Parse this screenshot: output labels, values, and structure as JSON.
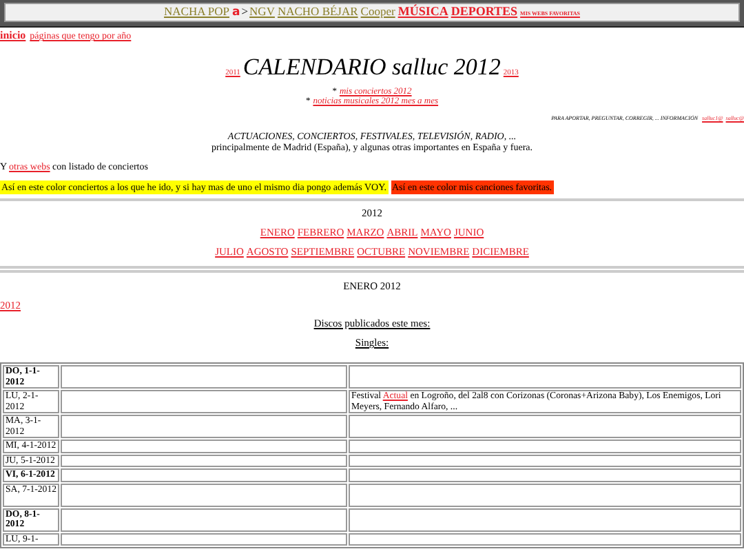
{
  "top_bar": [
    {
      "text": "NACHA POP",
      "kind": "olive"
    },
    {
      "text": "a",
      "kind": "sans"
    },
    {
      "text": ">",
      "kind": "plain"
    },
    {
      "text": "NGV",
      "kind": "olive"
    },
    {
      "text": "NACHO BÉJAR",
      "kind": "olive"
    },
    {
      "text": "Cooper",
      "kind": "olive"
    },
    {
      "text": "MÚSICA",
      "kind": "bold"
    },
    {
      "text": "DEPORTES",
      "kind": "bold"
    },
    {
      "text": "MIS WEBS FAVORITAS",
      "kind": "tiny"
    }
  ],
  "nav_links": [
    {
      "text": "inicio",
      "kind": "bold"
    },
    {
      "text": "páginas que tengo por año",
      "kind": "plain"
    }
  ],
  "title": {
    "prev": "2011",
    "text": "CALENDARIO salluc 2012",
    "next": "2013"
  },
  "featured_links": [
    {
      "bullet": "*",
      "text": "mis conciertos 2012"
    },
    {
      "bullet": "*",
      "text": "noticias musicales 2012 mes a mes"
    }
  ],
  "contact": {
    "text": "PARA APORTAR, PREGUNTAR, CORREGIR, ... INFORMACIÓN",
    "links": [
      "salluc1@",
      "salluc@"
    ]
  },
  "intro": {
    "heading": "ACTUACIONES, CONCIERTOS, FESTIVALES, TELEVISIÓN, RADIO, ...",
    "text": "principalmente de Madrid (España), y algunas otras importantes en España y fuera."
  },
  "other_webs": {
    "before": "Y",
    "link": "otras webs",
    "after": "con listado de conciertos"
  },
  "legend": [
    {
      "text": "Así en este color conciertos a los que he ido, y si hay mas de uno el mismo dia pongo además VOY.",
      "color": "#ffff00"
    },
    {
      "text": "Así en este color mis canciones favoritas.",
      "color": "#ff3300"
    }
  ],
  "year_label": "2012",
  "months": [
    [
      "ENERO",
      "FEBRERO",
      "MARZO",
      "ABRIL",
      "MAYO",
      "JUNIO"
    ],
    [
      "JULIO",
      "AGOSTO",
      "SEPTIEMBRE",
      "OCTUBRE",
      "NOVIEMBRE",
      "DICIEMBRE"
    ]
  ],
  "month_heading": "ENERO 2012",
  "year_link": "2012",
  "discs_heading": "Discos publicados este mes:",
  "singles_heading": "Singles:",
  "days": [
    {
      "day": "DO, 1-1-2012",
      "holiday": true
    },
    {
      "day": "LU, 2-1-2012",
      "holiday": false,
      "event": {
        "before": "Festival",
        "link": "Actual",
        "after": "en Logroño, del 2al8 con Corizonas (Coronas+Arizona Baby), Los Enemigos, Lori Meyers, Fernando Alfaro, ..."
      }
    },
    {
      "day": "MA, 3-1-2012",
      "holiday": false
    },
    {
      "day": "MI, 4-1-2012",
      "holiday": false
    },
    {
      "day": "JU, 5-1-2012",
      "holiday": false
    },
    {
      "day": "VI, 6-1-2012",
      "holiday": true
    },
    {
      "day": "SA, 7-1-2012",
      "holiday": false
    },
    {
      "day": "DO, 8-1-2012",
      "holiday": true
    },
    {
      "day": "LU, 9-1-",
      "holiday": false
    }
  ]
}
